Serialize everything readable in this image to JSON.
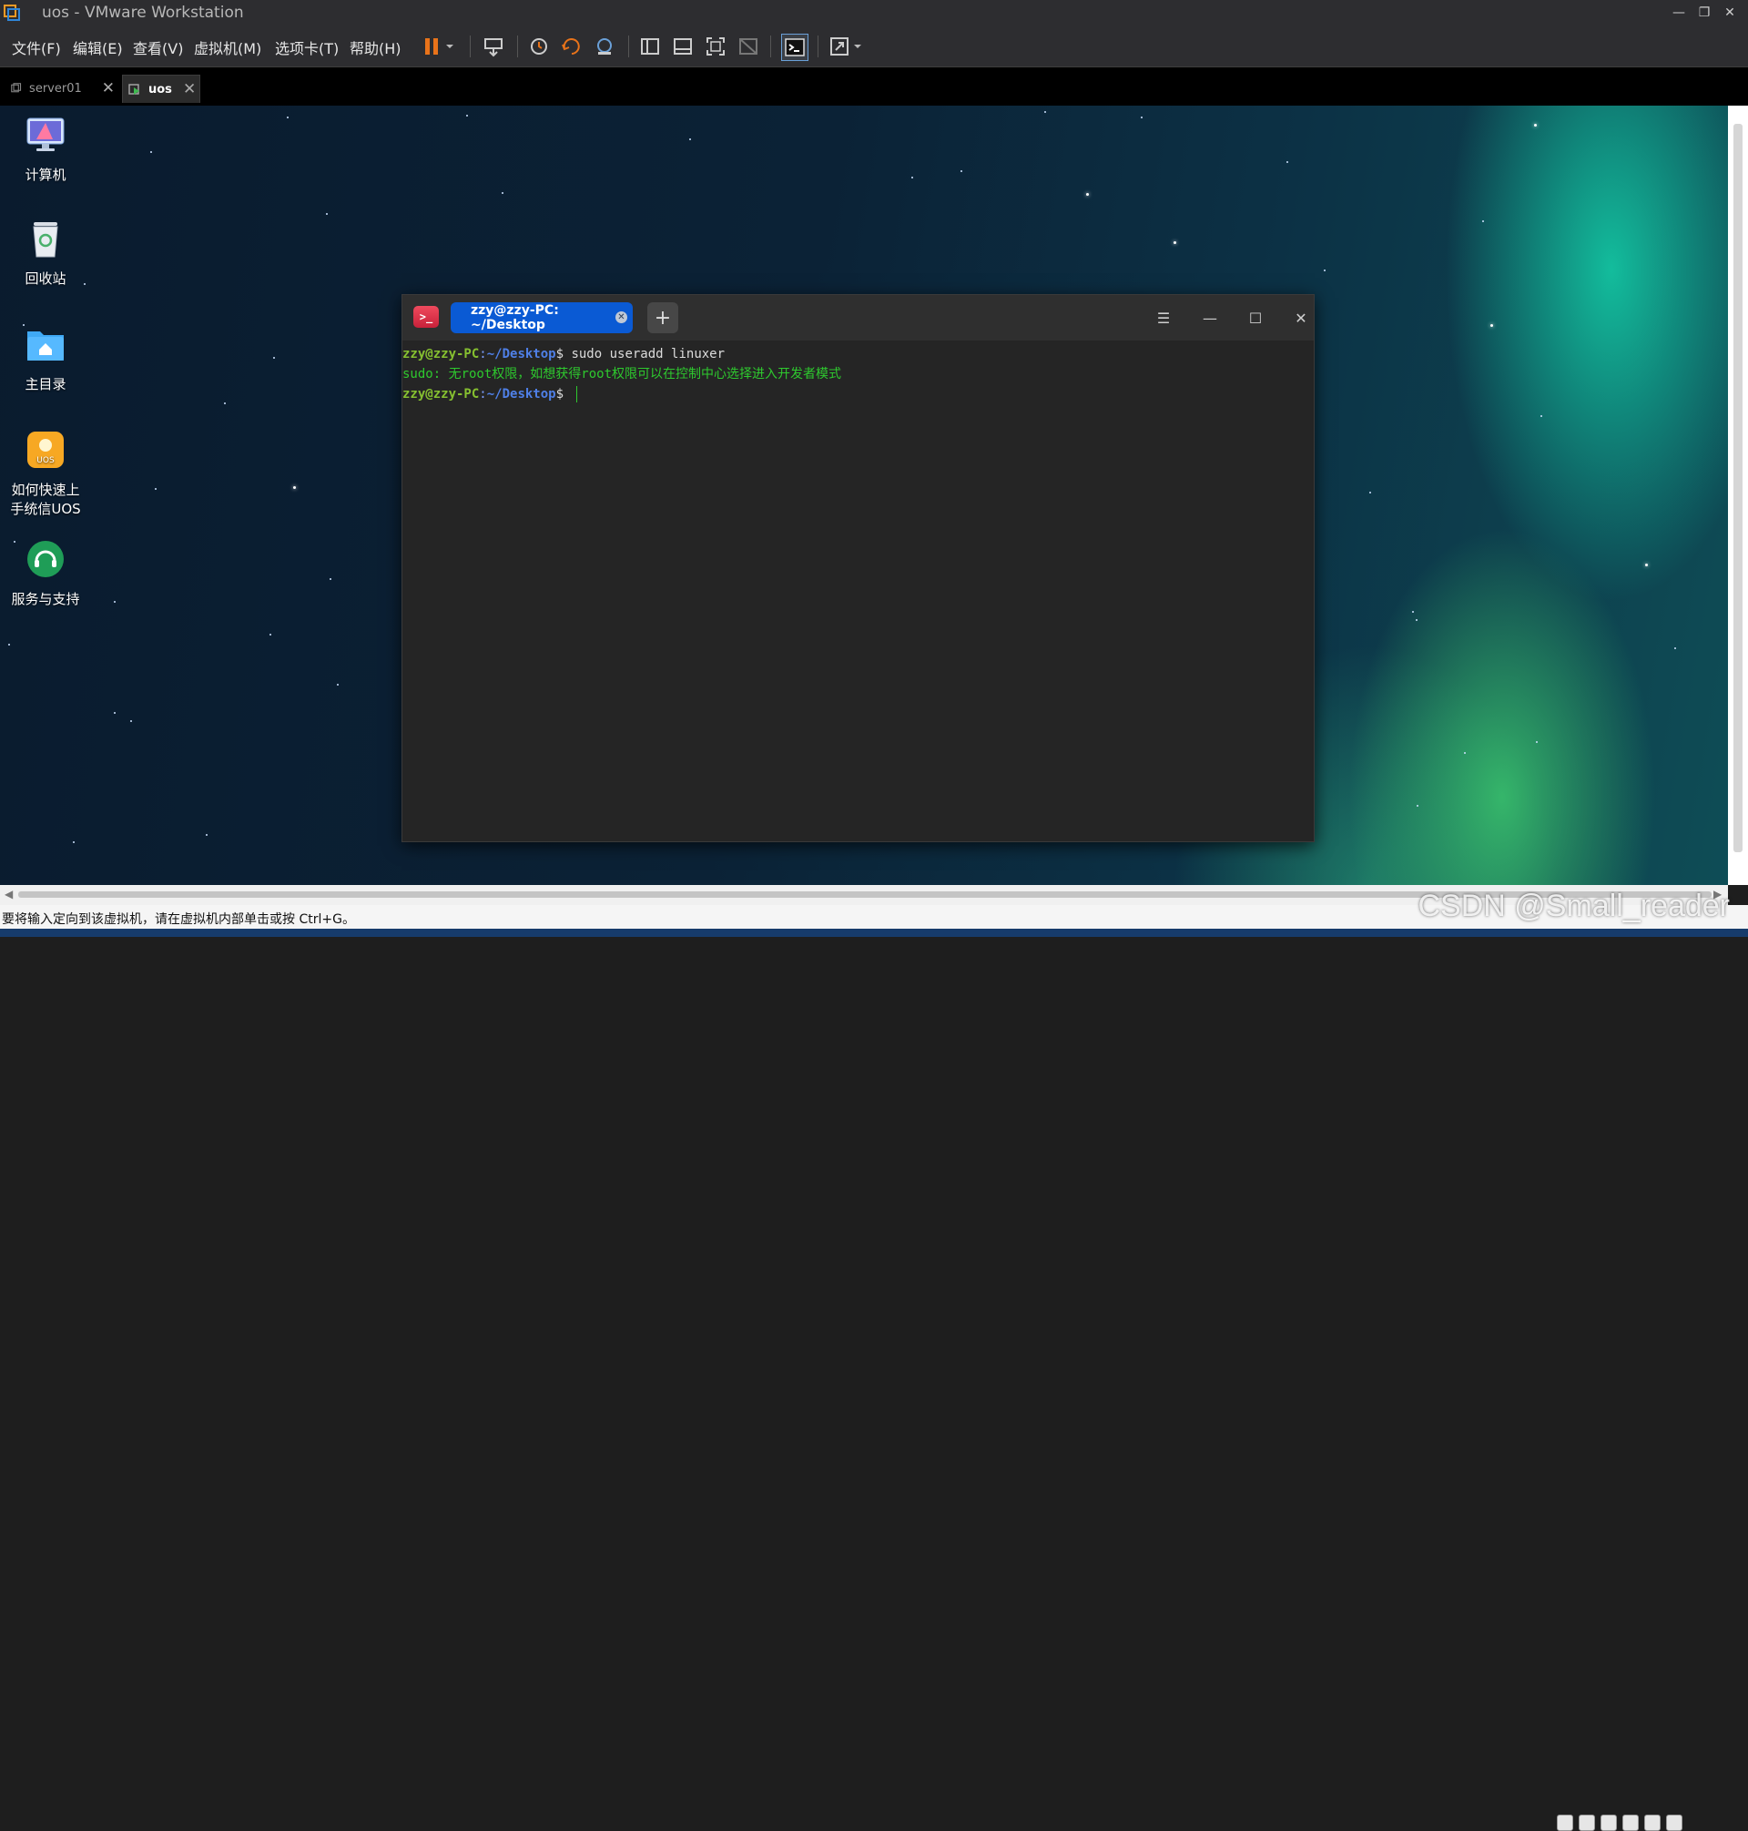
{
  "window": {
    "title": "uos - VMware Workstation"
  },
  "menu": [
    {
      "label": "文件(F)"
    },
    {
      "label": "编辑(E)"
    },
    {
      "label": "查看(V)"
    },
    {
      "label": "虚拟机(M)"
    },
    {
      "label": "选项卡(T)"
    },
    {
      "label": "帮助(H)"
    }
  ],
  "toolbar_icons": [
    "pause-icon",
    "send-ctrl-alt-del-icon",
    "snapshot-icon",
    "revert-snapshot-icon",
    "snapshot-manager-icon",
    "library-view-icon",
    "thumbnail-view-icon",
    "fullscreen-icon",
    "unity-icon",
    "console-view-icon",
    "stretch-icon"
  ],
  "tabs": [
    {
      "label": "server01",
      "active": false
    },
    {
      "label": "uos",
      "active": true
    }
  ],
  "desktop_icons": [
    {
      "label": "计算机",
      "icon": "computer-icon"
    },
    {
      "label": "回收站",
      "icon": "trash-icon"
    },
    {
      "label": "主目录",
      "icon": "home-folder-icon"
    },
    {
      "label": "如何快速上\n手统信UOS",
      "icon": "uos-tips-icon"
    },
    {
      "label": "服务与支持",
      "icon": "support-icon"
    }
  ],
  "terminal": {
    "tab_title": "zzy@zzy-PC: ~/Desktop",
    "add_label": "+",
    "lines": [
      {
        "user": "zzy@zzy-PC",
        "sep": ":",
        "path": "~/Desktop",
        "prompt": "$ ",
        "cmd": "sudo useradd linuxer"
      },
      {
        "error": "sudo: 无root权限，如想获得root权限可以在控制中心选择进入开发者模式"
      },
      {
        "user": "zzy@zzy-PC",
        "sep": ":",
        "path": "~/Desktop",
        "prompt": "$ ",
        "cmd": ""
      }
    ]
  },
  "status": {
    "message": "要将输入定向到该虚拟机，请在虚拟机内部单击或按 Ctrl+G。"
  },
  "watermark": "CSDN @Small_reader",
  "colors": {
    "accent": "#0a5ad4",
    "prompt_user": "#86c030",
    "prompt_path": "#4f80e8",
    "error": "#2ec92e",
    "pause": "#e8731a"
  }
}
